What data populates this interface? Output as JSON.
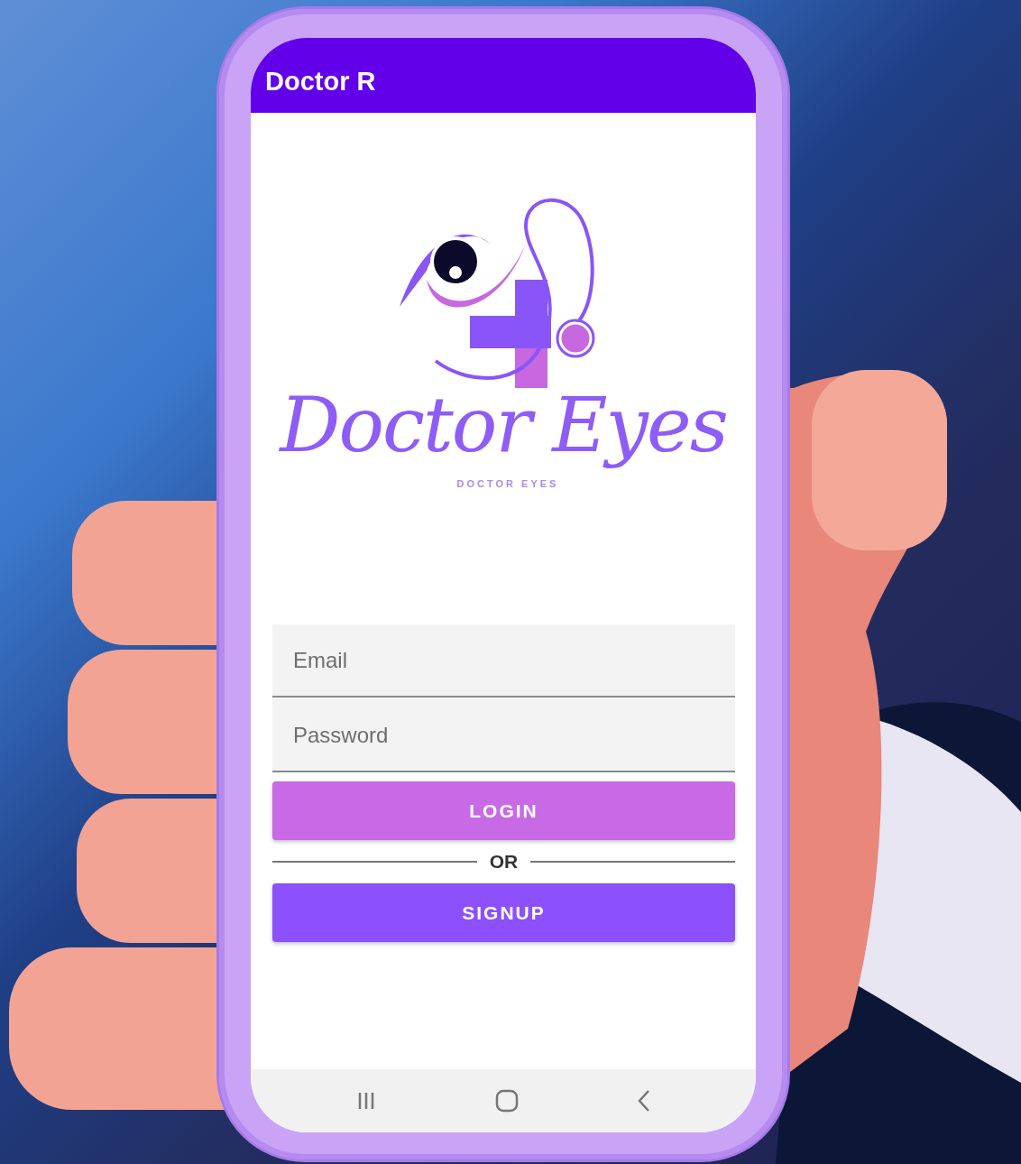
{
  "app_bar": {
    "title": "Doctor R"
  },
  "logo": {
    "script_text": "Doctor Eyes",
    "tagline": "DOCTOR EYES"
  },
  "fields": [
    {
      "placeholder": "Email"
    },
    {
      "placeholder": "Password"
    }
  ],
  "login_button": "LOGIN",
  "divider_text": "OR",
  "signup_button": "SIGNUP",
  "nav_bar": [
    {
      "kind": "recents"
    },
    {
      "kind": "home"
    },
    {
      "kind": "back"
    }
  ]
}
